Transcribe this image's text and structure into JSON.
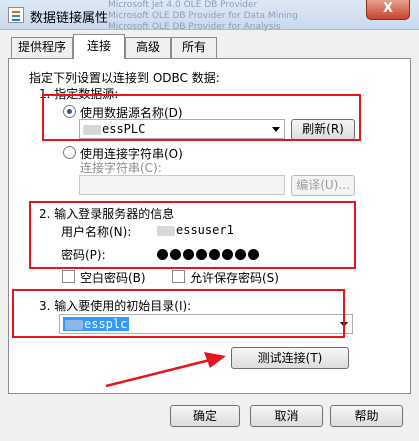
{
  "window": {
    "title": "数据链接属性",
    "ghost_lines": [
      "Microsoft Jet 4.0 OLE DB Provider",
      "Microsoft OLE DB Provider for Data Mining",
      "Microsoft OLE DB Provider for Analysis"
    ],
    "close_glyph": "X"
  },
  "tabs": [
    "提供程序",
    "连接",
    "高级",
    "所有"
  ],
  "intro": "指定下列设置以连接到 ODBC 数据:",
  "section1": {
    "heading": "1. 指定数据源:",
    "option_dsn": "使用数据源名称(D)",
    "dsn_value": "essPLC",
    "refresh": "刷新(R)",
    "option_connstr": "使用连接字符串(O)",
    "connstr_label": "连接字符串(C):",
    "build": "编译(U)..."
  },
  "section2": {
    "heading": "2. 输入登录服务器的信息",
    "username_label": "用户名称(N):",
    "username_value": "essuser1",
    "password_label": "密码(P):",
    "password_dots": 8,
    "blank_password": "空白密码(B)",
    "allow_save": "允许保存密码(S)"
  },
  "section3": {
    "heading": "3. 输入要使用的初始目录(I):",
    "catalog_value": "essplc"
  },
  "test_button": "测试连接(T)",
  "footer": {
    "ok": "确定",
    "cancel": "取消",
    "help": "帮助"
  }
}
